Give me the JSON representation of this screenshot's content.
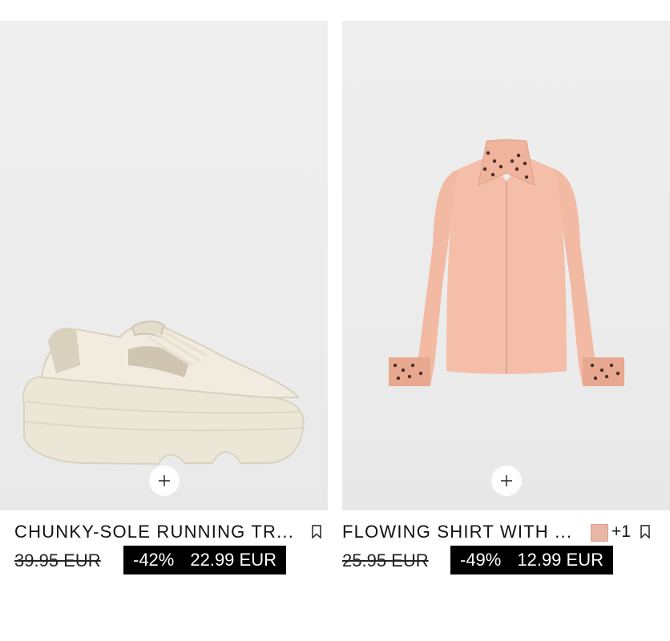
{
  "products": [
    {
      "name": "CHUNKY-SOLE RUNNING TR...",
      "old_price": "39.95 EUR",
      "discount": "-42%",
      "price": "22.99 EUR",
      "image": "sneaker-image"
    },
    {
      "name": "FLOWING SHIRT WITH ...",
      "old_price": "25.95 EUR",
      "discount": "-49%",
      "price": "12.99 EUR",
      "swatch_color": "#e8b6a6",
      "more_colors": "+1",
      "image": "shirt-image"
    }
  ]
}
